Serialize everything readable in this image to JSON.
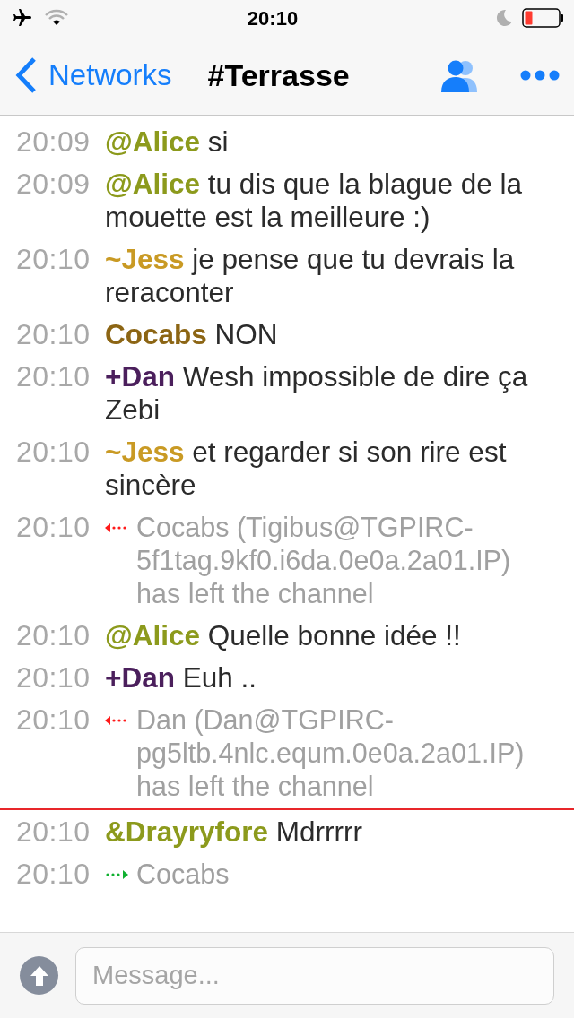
{
  "status_bar": {
    "time": "20:10"
  },
  "nav": {
    "back": "Networks",
    "title": "#Terrasse"
  },
  "messages": [
    {
      "kind": "message",
      "time": "20:09",
      "nick": "@Alice",
      "color": "#8c9a1c",
      "text": "si"
    },
    {
      "kind": "message",
      "time": "20:09",
      "nick": "@Alice",
      "color": "#8c9a1c",
      "text": "tu dis que la blague de la mouette est la meilleure :)"
    },
    {
      "kind": "message",
      "time": "20:10",
      "nick": "~Jess",
      "color": "#c99a24",
      "text": "je pense que tu devrais la reraconter"
    },
    {
      "kind": "message",
      "time": "20:10",
      "nick": "Cocabs",
      "color": "#8c6514",
      "text": "NON"
    },
    {
      "kind": "message",
      "time": "20:10",
      "nick": "+Dan",
      "color": "#4b1f5c",
      "text": "Wesh impossible de dire ça Zebi"
    },
    {
      "kind": "message",
      "time": "20:10",
      "nick": "~Jess",
      "color": "#c99a24",
      "text": "et regarder si son rire est sincère"
    },
    {
      "kind": "part",
      "time": "20:10",
      "text": "Cocabs (Tigibus@TGPIRC-5f1tag.9kf0.i6da.0e0a.2a01.IP) has left the channel"
    },
    {
      "kind": "message",
      "time": "20:10",
      "nick": "@Alice",
      "color": "#8c9a1c",
      "text": "Quelle bonne idée !!"
    },
    {
      "kind": "message",
      "time": "20:10",
      "nick": "+Dan",
      "color": "#4b1f5c",
      "text": "Euh .."
    },
    {
      "kind": "part",
      "time": "20:10",
      "text": "Dan (Dan@TGPIRC-pg5ltb.4nlc.equm.0e0a.2a01.IP) has left the channel"
    },
    {
      "kind": "marker"
    },
    {
      "kind": "message",
      "time": "20:10",
      "nick": "&Drayryfore",
      "color": "#8c9a1c",
      "text": "Mdrrrrr"
    },
    {
      "kind": "join",
      "time": "20:10",
      "text": "Cocabs"
    }
  ],
  "composer": {
    "placeholder": "Message..."
  }
}
